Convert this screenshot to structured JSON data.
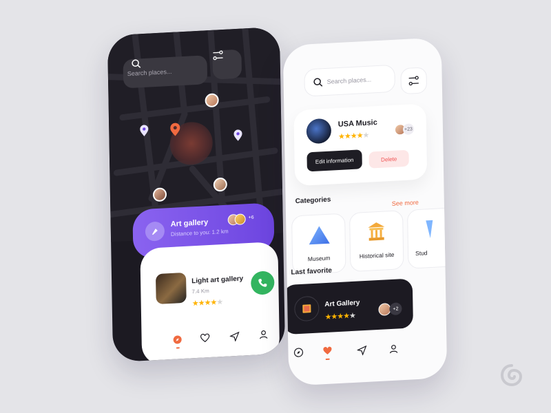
{
  "left_phone": {
    "search": {
      "placeholder": "Search places..."
    },
    "nearby_card": {
      "title": "Art gallery",
      "subtitle": "Distance to you: 1.2 km",
      "extra_count": "+6"
    },
    "place_card": {
      "title": "Light art gallery",
      "distance": "7.4 Km",
      "rating": 4
    },
    "nav": {
      "items": [
        "compass-icon",
        "heart-icon",
        "send-icon",
        "user-icon"
      ]
    }
  },
  "right_phone": {
    "search": {
      "placeholder": "Search places..."
    },
    "profile_card": {
      "title": "USA Music",
      "rating": 4,
      "followers": "+23",
      "edit_label": "Edit information",
      "delete_label": "Delete"
    },
    "categories": {
      "title": "Categories",
      "see_more": "See more",
      "items": [
        {
          "label": "Museum",
          "icon": "museum-triangle-icon"
        },
        {
          "label": "Historical site",
          "icon": "historical-building-icon"
        },
        {
          "label": "Stud",
          "icon": "studio-icon"
        }
      ]
    },
    "favorite": {
      "title": "Last favorite",
      "item_title": "Art Gallery",
      "rating": 4,
      "extra_count": "+2"
    },
    "nav": {
      "items": [
        "compass-icon",
        "heart-icon",
        "send-icon",
        "user-icon"
      ]
    }
  },
  "colors": {
    "accent_orange": "#f06a40",
    "purple": "#7b52e8",
    "green_call": "#33b560",
    "star": "#ffb300",
    "dark": "#1c1a22"
  }
}
